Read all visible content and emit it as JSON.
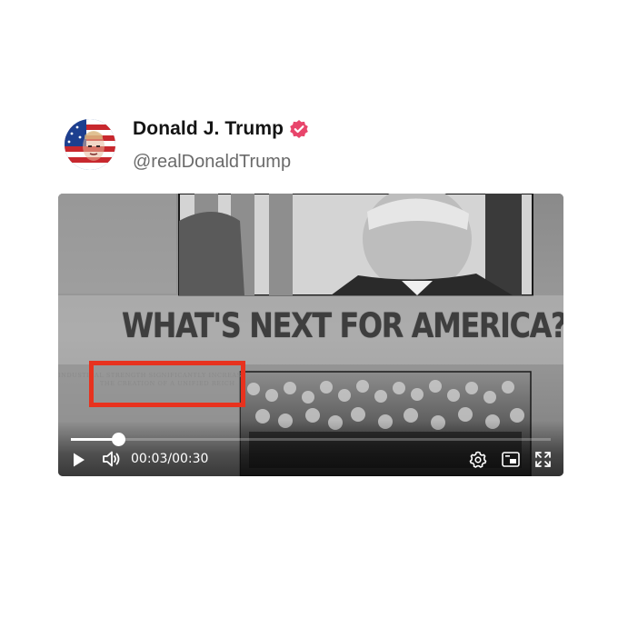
{
  "author": {
    "display_name": "Donald J. Trump",
    "handle": "@realDonaldTrump",
    "verified_color": "#e8456b"
  },
  "video": {
    "headline": "WHAT'S NEXT FOR AMERICA?",
    "overlay_text_line1": "INDUSTRIAL STRENGTH SIGNIFICANTLY INCREASED",
    "overlay_text_line2": "THE CREATION OF A UNIFIED REICH",
    "highlight_color": "#e8321e",
    "current_time": "00:03",
    "time_separator": "/",
    "duration": "00:30",
    "progress_fraction": 0.1,
    "icons": [
      "play-icon",
      "volume-icon",
      "settings-icon",
      "picture-in-picture-icon",
      "fullscreen-icon"
    ]
  }
}
